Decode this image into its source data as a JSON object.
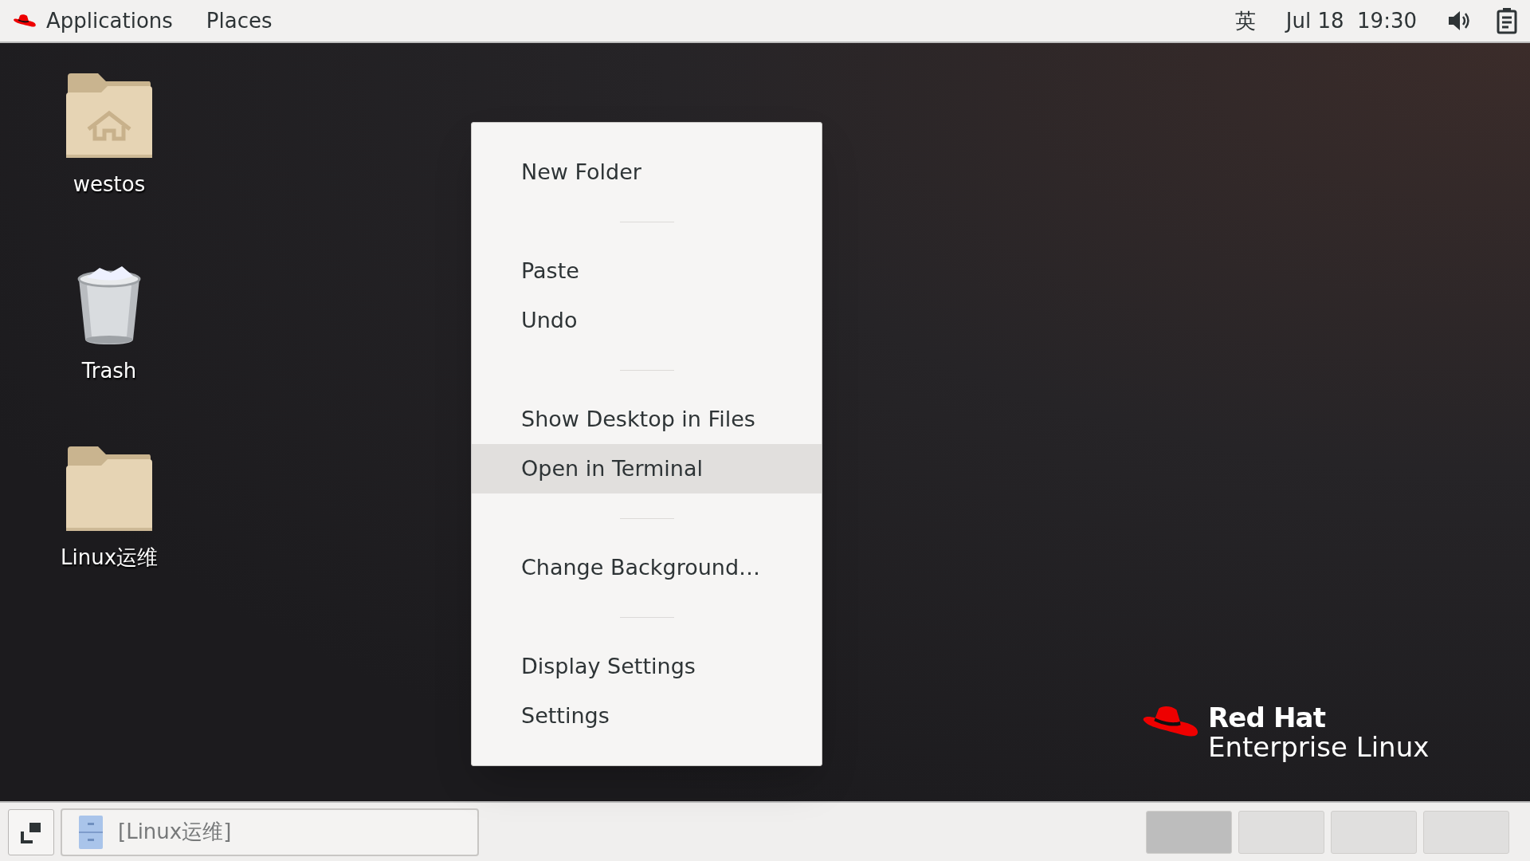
{
  "top_bar": {
    "menus": [
      "Applications",
      "Places"
    ],
    "input_method": "英",
    "clock": "Jul 18  19:30"
  },
  "desktop_icons": [
    {
      "kind": "home_folder",
      "label": "westos"
    },
    {
      "kind": "trash",
      "label": "Trash"
    },
    {
      "kind": "folder",
      "label": "Linux运维"
    }
  ],
  "context_menu": {
    "items": [
      {
        "kind": "item",
        "label": "New Folder",
        "selected": false
      },
      {
        "kind": "separator"
      },
      {
        "kind": "item",
        "label": "Paste",
        "selected": false
      },
      {
        "kind": "item",
        "label": "Undo",
        "selected": false
      },
      {
        "kind": "separator"
      },
      {
        "kind": "item",
        "label": "Show Desktop in Files",
        "selected": false
      },
      {
        "kind": "item",
        "label": "Open in Terminal",
        "selected": true
      },
      {
        "kind": "separator"
      },
      {
        "kind": "item",
        "label": "Change Background…",
        "selected": false
      },
      {
        "kind": "separator"
      },
      {
        "kind": "item",
        "label": "Display Settings",
        "selected": false
      },
      {
        "kind": "item",
        "label": "Settings",
        "selected": false
      }
    ]
  },
  "logo": {
    "line1": "Red Hat",
    "line2": "Enterprise Linux"
  },
  "taskbar": {
    "window_button": "[Linux运维]",
    "workspaces": [
      {
        "selected": true
      },
      {
        "selected": false
      },
      {
        "selected": false
      },
      {
        "selected": false
      }
    ]
  }
}
